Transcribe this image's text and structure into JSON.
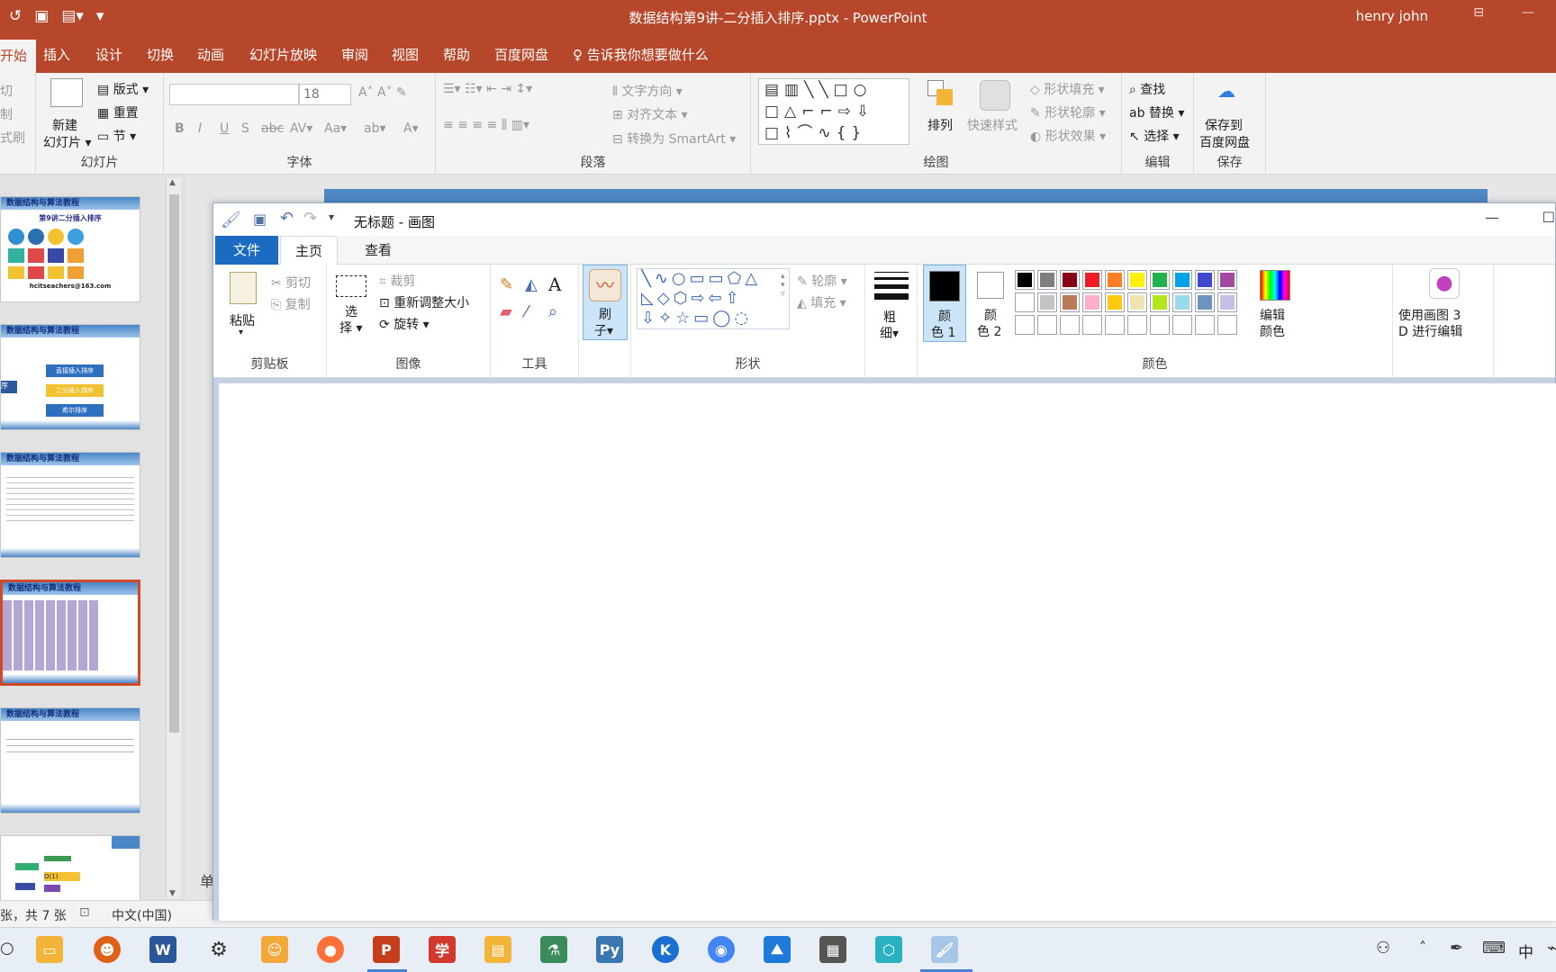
{
  "ppt": {
    "document_title": "数据结构第9讲-二分插入排序.pptx  -  PowerPoint",
    "user": "henry john",
    "tabs": [
      "开始",
      "插入",
      "设计",
      "切换",
      "动画",
      "幻灯片放映",
      "审阅",
      "视图",
      "帮助",
      "百度网盘"
    ],
    "tell_me": "告诉我你想要做什么",
    "ribbon": {
      "clipboard_partial": [
        "切",
        "制",
        "式刷"
      ],
      "new_slide": "新建",
      "new_slide_2": "幻灯片",
      "layout": "版式",
      "reset": "重置",
      "section": "节",
      "slides_group": "幻灯片",
      "font_size": "18",
      "font_group": "字体",
      "text_direction": "文字方向",
      "align_text": "对齐文本",
      "smartart": "转换为 SmartArt",
      "paragraph_group": "段落",
      "arrange": "排列",
      "quick_styles": "快速样式",
      "shape_fill": "形状填充",
      "shape_outline": "形状轮廓",
      "shape_effects": "形状效果",
      "drawing_group": "绘图",
      "find": "查找",
      "replace": "替换",
      "select": "选择",
      "editing_group": "编辑",
      "save_baidu_1": "保存到",
      "save_baidu_2": "百度网盘",
      "save_group": "保存"
    },
    "thumbnails": [
      {
        "header": "数据结构与算法教程",
        "subtitle": "第9讲二分插入排序",
        "footer": "hcitseachers@163.com"
      },
      {
        "header": "数据结构与算法教程",
        "items": [
          "直接插入排序",
          "二分插入排序",
          "希尔排序"
        ],
        "left": "序"
      },
      {
        "header": "数据结构与算法教程"
      },
      {
        "header": "数据结构与算法教程"
      },
      {
        "header": "数据结构与算法教程"
      },
      {
        "header": "",
        "badge": "O(1)"
      }
    ],
    "notes_char": "单",
    "status": {
      "slide_info": "张，共 7 张",
      "language": "中文(中国)"
    }
  },
  "paint": {
    "title": "无标题 - 画图",
    "tabs": {
      "file": "文件",
      "home": "主页",
      "view": "查看"
    },
    "clipboard": {
      "paste": "粘贴",
      "cut": "剪切",
      "copy": "复制",
      "label": "剪贴板"
    },
    "image": {
      "select_1": "选",
      "select_2": "择",
      "crop": "裁剪",
      "resize": "重新调整大小",
      "rotate": "旋转",
      "label": "图像"
    },
    "tools": {
      "label": "工具"
    },
    "brushes": {
      "label_1": "刷",
      "label_2": "子"
    },
    "shapes": {
      "outline": "轮廓",
      "fill": "填充",
      "label": "形状"
    },
    "size": {
      "label_1": "粗",
      "label_2": "细"
    },
    "colors": {
      "color1_a": "颜",
      "color1_b": "色 1",
      "color2_a": "颜",
      "color2_b": "色 2",
      "edit_colors_1": "编辑",
      "edit_colors_2": "颜色",
      "paint3d_1": "使用画图 3",
      "paint3d_2": "D 进行编辑",
      "label": "颜色",
      "palette_row1": [
        "#000000",
        "#7f7f7f",
        "#880015",
        "#ed1c24",
        "#ff7f27",
        "#fff200",
        "#22b14c",
        "#00a2e8",
        "#3f48cc",
        "#a349a4"
      ],
      "palette_row2": [
        "#ffffff",
        "#c3c3c3",
        "#b97a57",
        "#ffaec9",
        "#ffc90e",
        "#efe4b0",
        "#b5e61d",
        "#99d9ea",
        "#7092be",
        "#c8bfe7"
      ]
    }
  },
  "taskbar": {
    "ime": "中"
  }
}
